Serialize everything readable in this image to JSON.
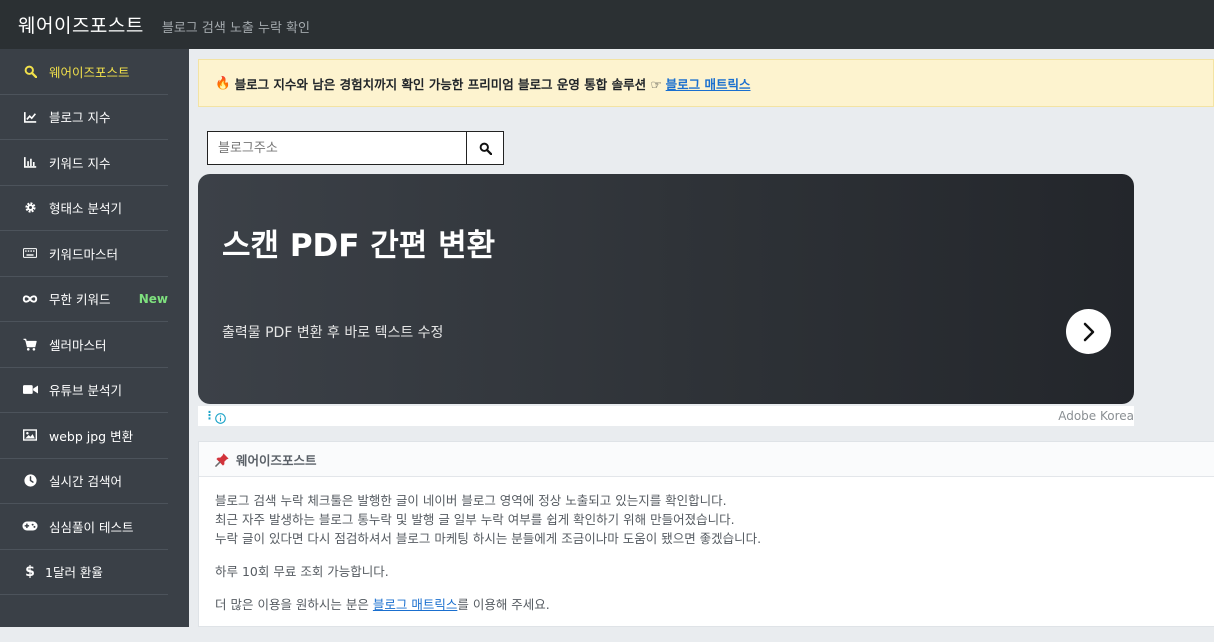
{
  "header": {
    "brand": "웨어이즈포스트",
    "tagline": "블로그 검색 노출 누락 확인"
  },
  "sidebar": {
    "items": [
      {
        "label": "웨어이즈포스트",
        "icon": "search-icon",
        "active": true
      },
      {
        "label": "블로그 지수",
        "icon": "line-chart-icon"
      },
      {
        "label": "키워드 지수",
        "icon": "bar-chart-icon"
      },
      {
        "label": "형태소 분석기",
        "icon": "gear-icon"
      },
      {
        "label": "키워드마스터",
        "icon": "keyboard-icon"
      },
      {
        "label": "무한 키워드",
        "icon": "infinity-icon",
        "badge": "New"
      },
      {
        "label": "셀러마스터",
        "icon": "cart-icon"
      },
      {
        "label": "유튜브 분석기",
        "icon": "video-camera-icon"
      },
      {
        "label": "webp jpg 변환",
        "icon": "image-icon"
      },
      {
        "label": "실시간 검색어",
        "icon": "clock-icon"
      },
      {
        "label": "심심풀이 테스트",
        "icon": "gamepad-icon"
      },
      {
        "label": "1달러 환율",
        "icon": "dollar-icon"
      }
    ],
    "accent": "#f2e14b",
    "badge_color": "#7ee07e"
  },
  "banner": {
    "emoji": "🔥",
    "text": "블로그 지수와 남은 경험치까지 확인 가능한 프리미엄 블로그 운영 통합 솔루션 ☞",
    "link": "블로그 매트릭스"
  },
  "search": {
    "placeholder": "블로그주소",
    "icon": "search-icon"
  },
  "ad": {
    "title": "스캔 PDF 간편 변환",
    "subtitle": "출력물 PDF 변환 후 바로 텍스트 수정",
    "advertiser": "Adobe Korea"
  },
  "card": {
    "title": "웨어이즈포스트",
    "icon": "pushpin-icon",
    "lines": [
      "블로그 검색 누락 체크툴은 발행한 글이 네이버 블로그 영역에 정상 노출되고 있는지를 확인합니다.",
      "최근 자주 발생하는 블로그 통누락 및 발행 글 일부 누락 여부를 쉽게 확인하기 위해 만들어졌습니다.",
      "누락 글이 있다면 다시 점검하셔서 블로그 마케팅 하시는 분들에게 조금이나마 도움이 됐으면 좋겠습니다."
    ],
    "limit_text": "하루 10회 무료 조회 가능합니다.",
    "more_prefix": "더 많은 이용을 원하시는 분은 ",
    "more_link": "블로그 매트릭스",
    "more_suffix": "를 이용해 주세요."
  }
}
